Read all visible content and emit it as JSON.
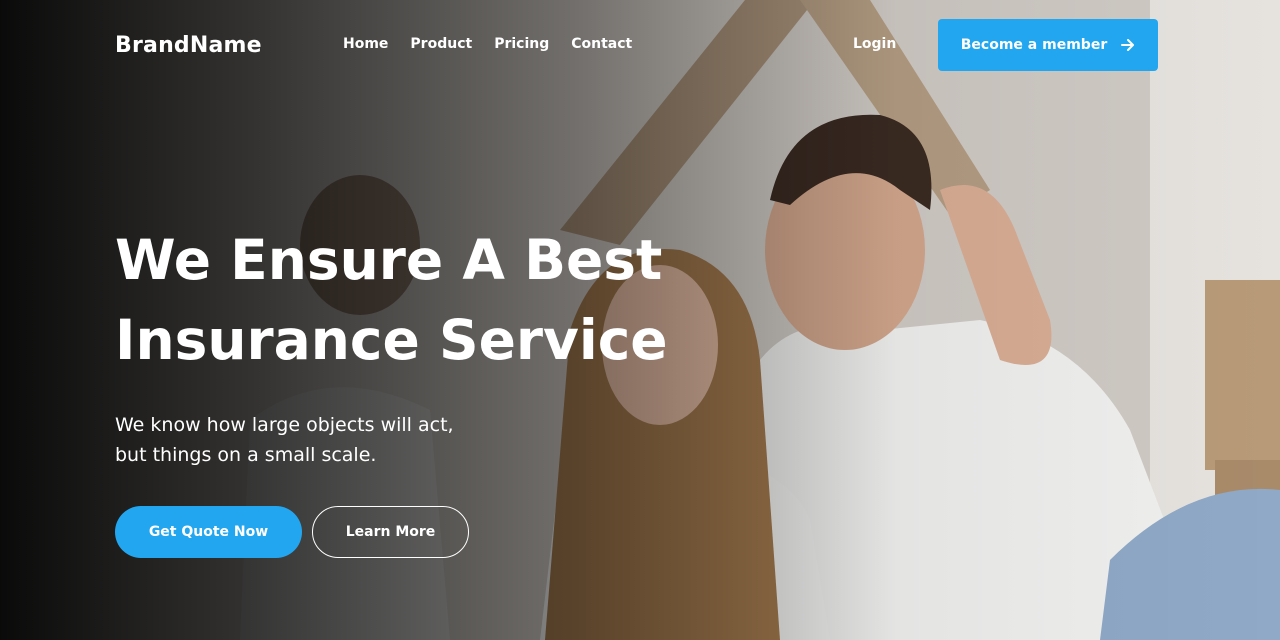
{
  "header": {
    "brand": "BrandName",
    "nav": [
      "Home",
      "Product",
      "Pricing",
      "Contact"
    ],
    "login_label": "Login",
    "member_label": "Become a member",
    "member_icon": "arrow-right-icon"
  },
  "hero": {
    "headline": [
      "We Ensure A Best",
      "Insurance Service"
    ],
    "subtext": [
      "We know how large objects will act,",
      "but things on a small scale."
    ],
    "primary_cta": "Get Quote Now",
    "secondary_cta": "Learn More",
    "image": "family-under-cardboard-roof-photo"
  },
  "colors": {
    "accent": "#23a6f0",
    "text": "#ffffff",
    "overlay": "#000000"
  }
}
